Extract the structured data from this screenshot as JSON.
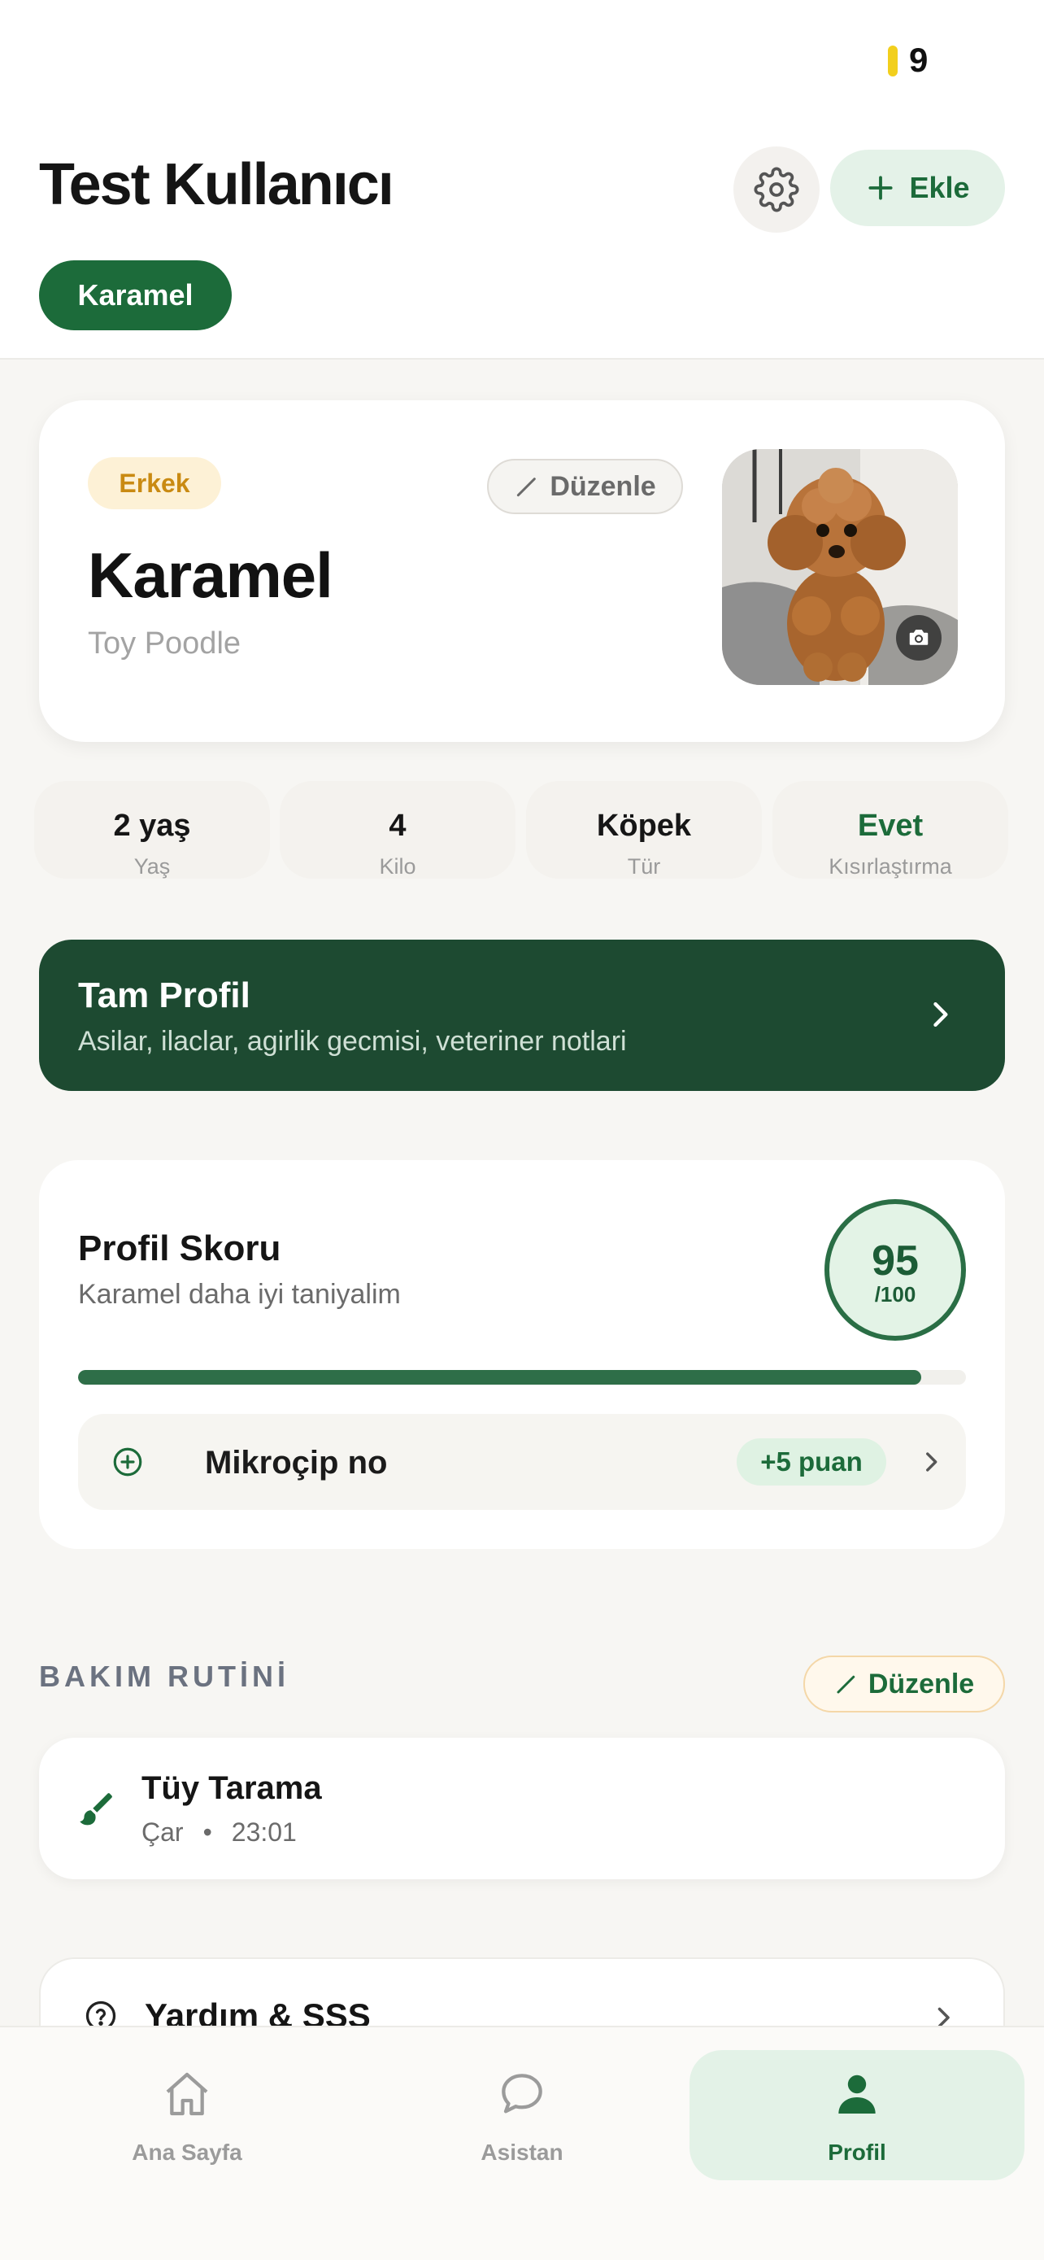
{
  "status_bar": {
    "battery_value": "9"
  },
  "header": {
    "user_name": "Test Kullanıcı",
    "add_label": "Ekle",
    "pet_tabs": [
      "Karamel"
    ]
  },
  "pet": {
    "gender": "Erkek",
    "edit_label": "Düzenle",
    "name": "Karamel",
    "breed": "Toy Poodle",
    "photo_icon": "camera-icon"
  },
  "stats": [
    {
      "value": "2 yaş",
      "label": "Yaş"
    },
    {
      "value": "4",
      "label": "Kilo"
    },
    {
      "value": "Köpek",
      "label": "Tür"
    },
    {
      "value": "Evet",
      "label": "Kısırlaştırma"
    }
  ],
  "full_profile": {
    "title": "Tam Profil",
    "subtitle": "Asilar, ilaclar, agirlik gecmisi, veteriner notlari"
  },
  "score": {
    "title": "Profil Skoru",
    "subtitle": "Karamel daha iyi taniyalim",
    "value": "95",
    "max": "/100",
    "progress_percent": 95,
    "task_label": "Mikroçip no",
    "task_points": "+5 puan"
  },
  "routine": {
    "section_title": "BAKIM RUTİNİ",
    "edit_label": "Düzenle",
    "items": [
      {
        "name": "Tüy Tarama",
        "day": "Çar",
        "time": "23:01"
      }
    ]
  },
  "help": {
    "label": "Yardım & SSS"
  },
  "tabbar": {
    "items": [
      {
        "label": "Ana Sayfa",
        "icon": "home-icon"
      },
      {
        "label": "Asistan",
        "icon": "chat-icon"
      },
      {
        "label": "Profil",
        "icon": "person-icon"
      }
    ],
    "active": "Profil"
  },
  "colors": {
    "brand_green": "#1c6b3a",
    "dark_green": "#1d4a31",
    "accent_yellow": "#f2cf1d",
    "gender_orange": "#c98a12",
    "evet_green": "#1c6b3a"
  }
}
